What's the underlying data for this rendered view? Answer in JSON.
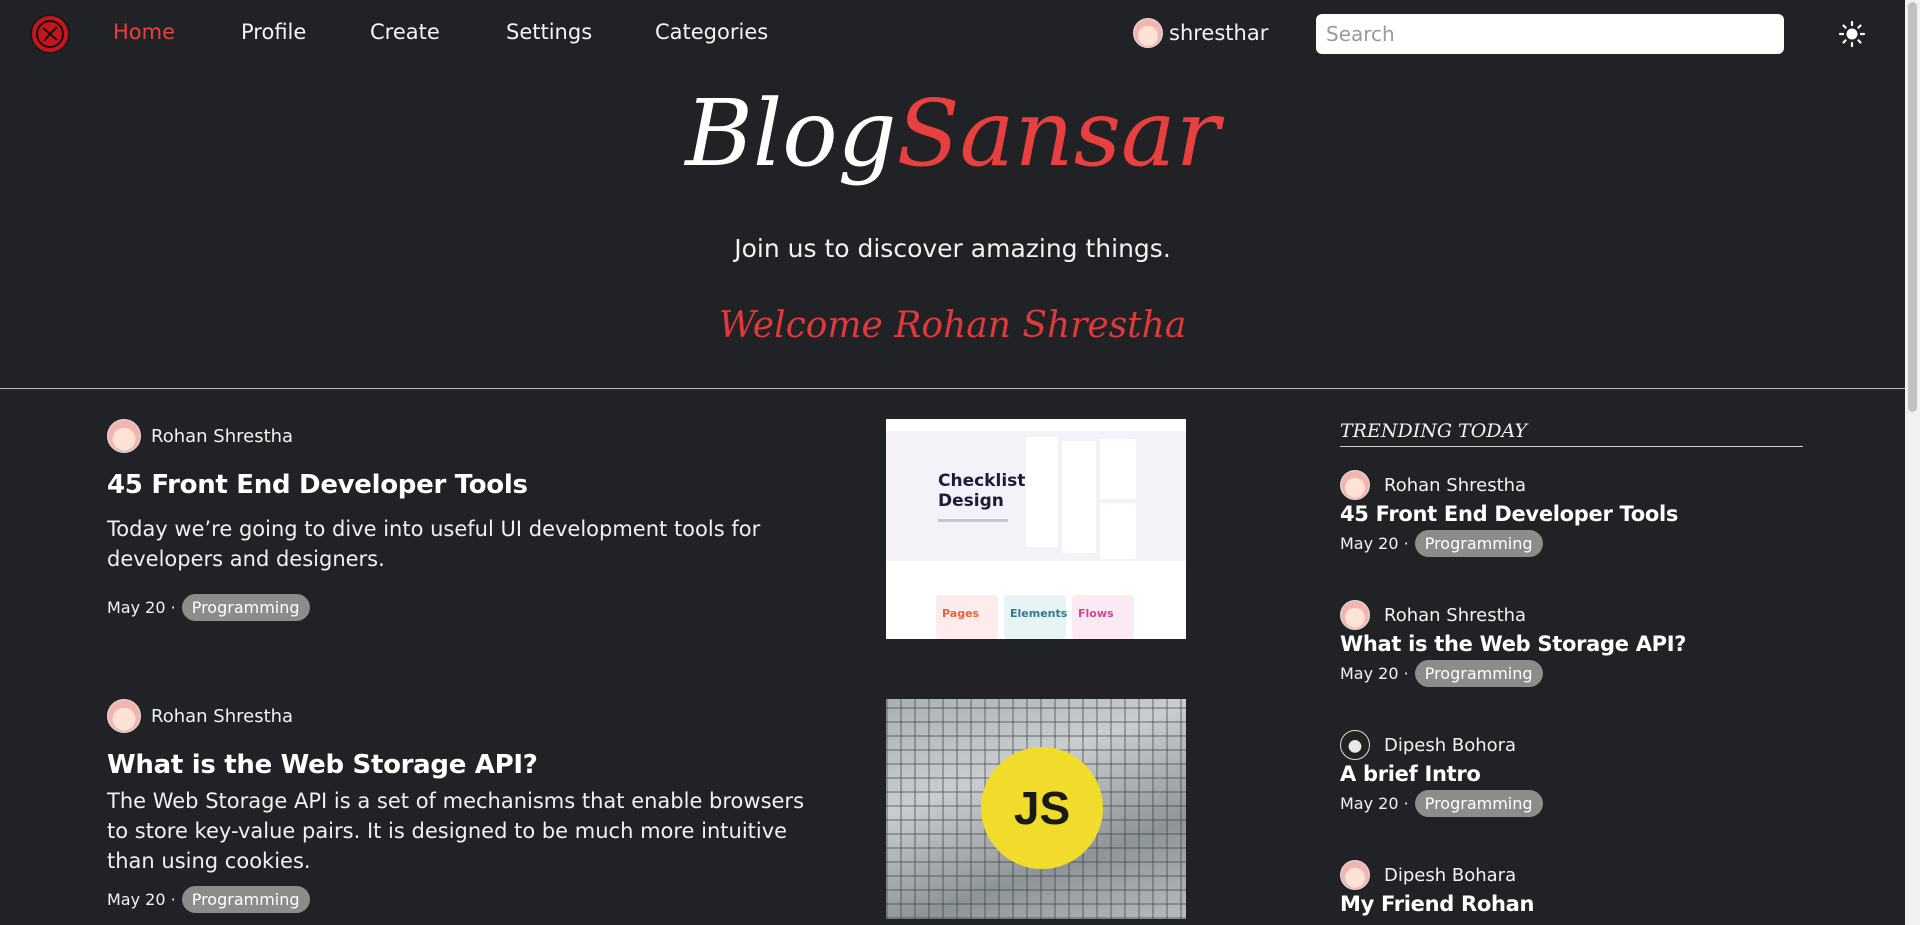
{
  "nav": {
    "links": [
      "Home",
      "Profile",
      "Create",
      "Settings",
      "Categories"
    ],
    "active": "Home",
    "username": "shresthar",
    "search_placeholder": "Search"
  },
  "hero": {
    "title_part1": "Blog",
    "title_part2": "Sansar",
    "tagline": "Join us to discover amazing things.",
    "welcome": "Welcome Rohan Shrestha"
  },
  "posts": [
    {
      "author": "Rohan Shrestha",
      "title": "45 Front End Developer Tools",
      "excerpt": "Today we’re going to dive into useful UI development tools for developers and designers.",
      "date": "May 20 ·",
      "category": "Programming",
      "thumb": {
        "heading_line1": "Checklist",
        "heading_line2": "Design",
        "tiles": [
          "Pages",
          "Elements",
          "Flows"
        ]
      }
    },
    {
      "author": "Rohan Shrestha",
      "title": "What is the Web Storage API?",
      "excerpt": "The Web Storage API is a set of mechanisms that enable browsers to store key-value pairs. It is designed to be much more intuitive than using cookies.",
      "date": "May 20 ·",
      "category": "Programming",
      "thumb": {
        "badge": "JS"
      }
    }
  ],
  "trending": {
    "heading": "TRENDING TODAY",
    "items": [
      {
        "author": "Rohan Shrestha",
        "title": "45 Front End Developer Tools",
        "date": "May 20 ·",
        "category": "Programming"
      },
      {
        "author": "Rohan Shrestha",
        "title": "What is the Web Storage API?",
        "date": "May 20 ·",
        "category": "Programming"
      },
      {
        "author": "Dipesh Bohora",
        "title": "A brief Intro",
        "date": "May 20 ·",
        "category": "Programming"
      },
      {
        "author": "Dipesh Bohara",
        "title": "My Friend Rohan",
        "date": "",
        "category": ""
      }
    ]
  },
  "colors": {
    "background": "#212226",
    "accent": "#e8403e",
    "tag": "#8c8c8c"
  }
}
